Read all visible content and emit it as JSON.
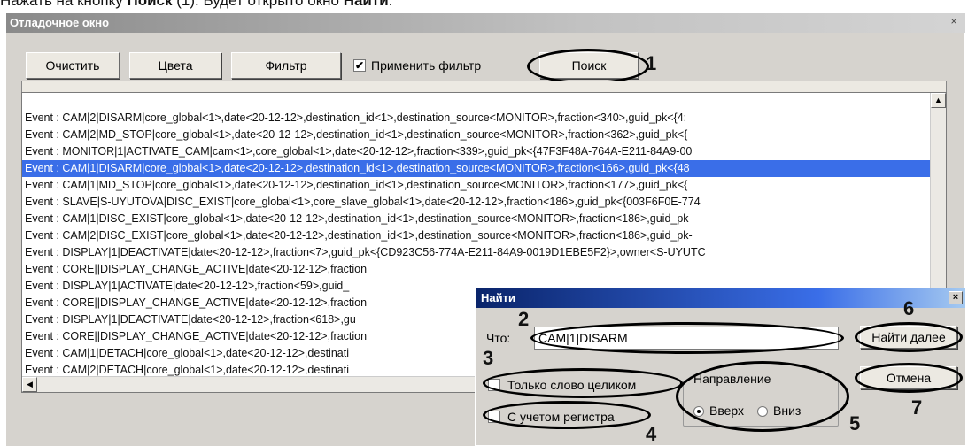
{
  "caption": {
    "prefix": "Нажать на кнопку ",
    "bold1": "Поиск",
    "mid": " (1). Будет открыто окно ",
    "bold2": "Найти",
    "suffix": "."
  },
  "debug_window": {
    "title": "Отладочное окно",
    "buttons": {
      "clear": "Очистить",
      "colors": "Цвета",
      "filter": "Фильтр",
      "search": "Поиск"
    },
    "apply_filter": {
      "label": "Применить фильтр",
      "checked": "✔"
    },
    "log_lines": [
      "Event : CAM|2|DISARM|core_global<1>,date<20-12-12>,destination_id<1>,destination_source<MONITOR>,fraction<340>,guid_pk<{4:",
      "Event : CAM|2|MD_STOP|core_global<1>,date<20-12-12>,destination_id<1>,destination_source<MONITOR>,fraction<362>,guid_pk<{",
      "Event : MONITOR|1|ACTIVATE_CAM|cam<1>,core_global<1>,date<20-12-12>,fraction<339>,guid_pk<{47F3F48A-764A-E211-84A9-00",
      "Event : CAM|1|DISARM|core_global<1>,date<20-12-12>,destination_id<1>,destination_source<MONITOR>,fraction<166>,guid_pk<{48",
      "Event : CAM|1|MD_STOP|core_global<1>,date<20-12-12>,destination_id<1>,destination_source<MONITOR>,fraction<177>,guid_pk<{",
      "Event : SLAVE|S-UYUTOVA|DISC_EXIST|core_global<1>,core_slave_global<1>,date<20-12-12>,fraction<186>,guid_pk<{003F6F0E-774",
      "Event : CAM|1|DISC_EXIST|core_global<1>,date<20-12-12>,destination_id<1>,destination_source<MONITOR>,fraction<186>,guid_pk-",
      "Event : CAM|2|DISC_EXIST|core_global<1>,date<20-12-12>,destination_id<1>,destination_source<MONITOR>,fraction<186>,guid_pk-",
      "Event : DISPLAY|1|DEACTIVATE|date<20-12-12>,fraction<7>,guid_pk<{CD923C56-774A-E211-84A9-0019D1EBE5F2}>,owner<S-UYUTC",
      "Event : CORE||DISPLAY_CHANGE_ACTIVE|date<20-12-12>,fraction",
      "Event : DISPLAY|1|ACTIVATE|date<20-12-12>,fraction<59>,guid_",
      "Event : CORE||DISPLAY_CHANGE_ACTIVE|date<20-12-12>,fraction",
      "Event : DISPLAY|1|DEACTIVATE|date<20-12-12>,fraction<618>,gu",
      "Event : CORE||DISPLAY_CHANGE_ACTIVE|date<20-12-12>,fraction",
      "Event : CAM|1|DETACH|core_global<1>,date<20-12-12>,destinati",
      "Event : CAM|2|DETACH|core_global<1>,date<20-12-12>,destinati"
    ],
    "selected_index": 3
  },
  "find_dialog": {
    "title": "Найти",
    "what_label": "Что:",
    "what_value": "CAM|1|DISARM",
    "find_next": "Найти далее",
    "cancel": "Отмена",
    "whole_word": "Только слово целиком",
    "match_case": "С учетом регистра",
    "direction_label": "Направление",
    "up": "Вверх",
    "down": "Вниз"
  },
  "callouts": [
    "1",
    "2",
    "3",
    "4",
    "5",
    "6",
    "7"
  ],
  "icons": {
    "close": "×",
    "scroll_up": "▲",
    "scroll_left": "◀"
  }
}
